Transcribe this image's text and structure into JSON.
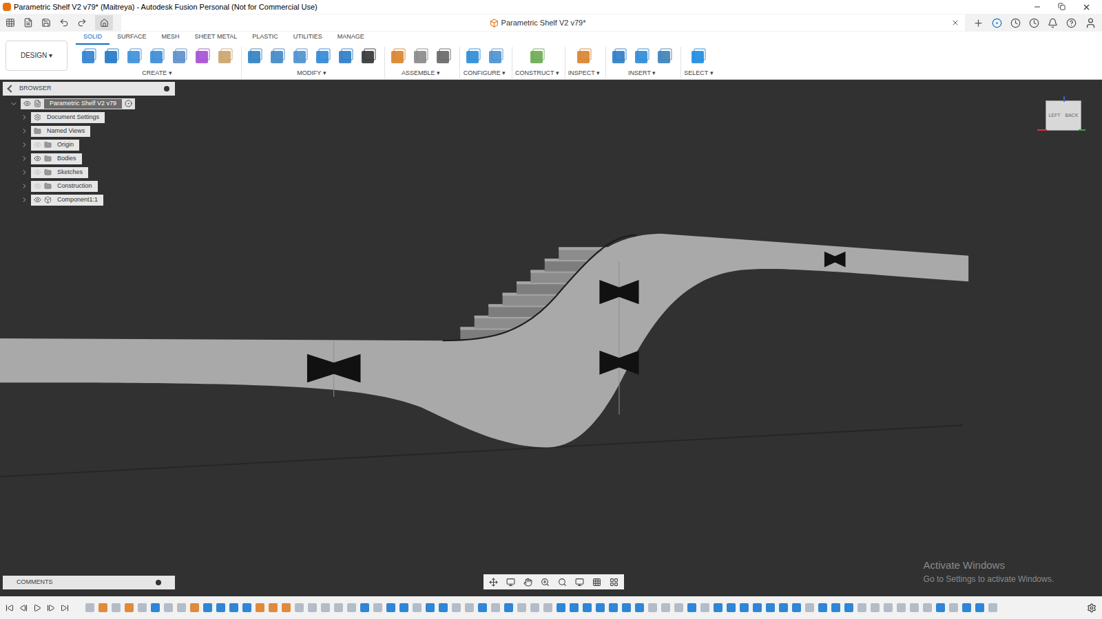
{
  "window": {
    "title": "Parametric Shelf V2 v79* (Maitreya) - Autodesk Fusion Personal (Not for Commercial Use)"
  },
  "document_tab": {
    "title": "Parametric Shelf V2 v79*"
  },
  "workspace": {
    "label": "DESIGN ▾"
  },
  "toolbar_tabs": [
    {
      "label": "SOLID",
      "selected": true
    },
    {
      "label": "SURFACE",
      "selected": false
    },
    {
      "label": "MESH",
      "selected": false
    },
    {
      "label": "SHEET METAL",
      "selected": false
    },
    {
      "label": "PLASTIC",
      "selected": false
    },
    {
      "label": "UTILITIES",
      "selected": false
    },
    {
      "label": "MANAGE",
      "selected": false
    }
  ],
  "tool_groups": [
    {
      "label": "CREATE ▾"
    },
    {
      "label": "MODIFY ▾"
    },
    {
      "label": "ASSEMBLE ▾"
    },
    {
      "label": "CONFIGURE ▾"
    },
    {
      "label": "CONSTRUCT ▾"
    },
    {
      "label": "INSPECT ▾"
    },
    {
      "label": "INSERT ▾"
    },
    {
      "label": "SELECT ▾"
    }
  ],
  "browser": {
    "title": "BROWSER",
    "root": {
      "label": "Parametric Shelf V2 v79",
      "expanded": true,
      "visible": true
    },
    "items": [
      {
        "label": "Document Settings",
        "kind": "settings"
      },
      {
        "label": "Named Views",
        "kind": "views"
      },
      {
        "label": "Origin",
        "kind": "folder",
        "visible": false
      },
      {
        "label": "Bodies",
        "kind": "folder",
        "visible": true
      },
      {
        "label": "Sketches",
        "kind": "folder",
        "visible": false
      },
      {
        "label": "Construction",
        "kind": "folder",
        "visible": false
      },
      {
        "label": "Component1:1",
        "kind": "component",
        "visible": true
      }
    ]
  },
  "viewcube": {
    "faces": [
      "LEFT",
      "BACK"
    ]
  },
  "comments": {
    "label": "COMMENTS"
  },
  "watermark": {
    "title": "Activate Windows",
    "subtitle": "Go to Settings to activate Windows."
  },
  "timeline": {
    "features": [
      "sketch",
      "mod",
      "sketch",
      "mod",
      "sketch",
      "body",
      "sketch",
      "sketch",
      "mod",
      "body",
      "body",
      "body",
      "body",
      "mod",
      "mod",
      "mod",
      "sketch",
      "sketch",
      "sketch",
      "sketch",
      "sketch",
      "body",
      "sketch",
      "body",
      "body",
      "sketch",
      "body",
      "body",
      "sketch",
      "sketch",
      "body",
      "sketch",
      "body",
      "sketch",
      "sketch",
      "sketch",
      "body",
      "body",
      "body",
      "body",
      "body",
      "body",
      "body",
      "sketch",
      "sketch",
      "sketch",
      "body",
      "sketch",
      "body",
      "body",
      "body",
      "body",
      "body",
      "body",
      "body",
      "sketch",
      "body",
      "body",
      "body",
      "sketch",
      "sketch",
      "sketch",
      "sketch",
      "sketch",
      "sketch",
      "body",
      "sketch",
      "body",
      "body",
      "sketch"
    ]
  }
}
